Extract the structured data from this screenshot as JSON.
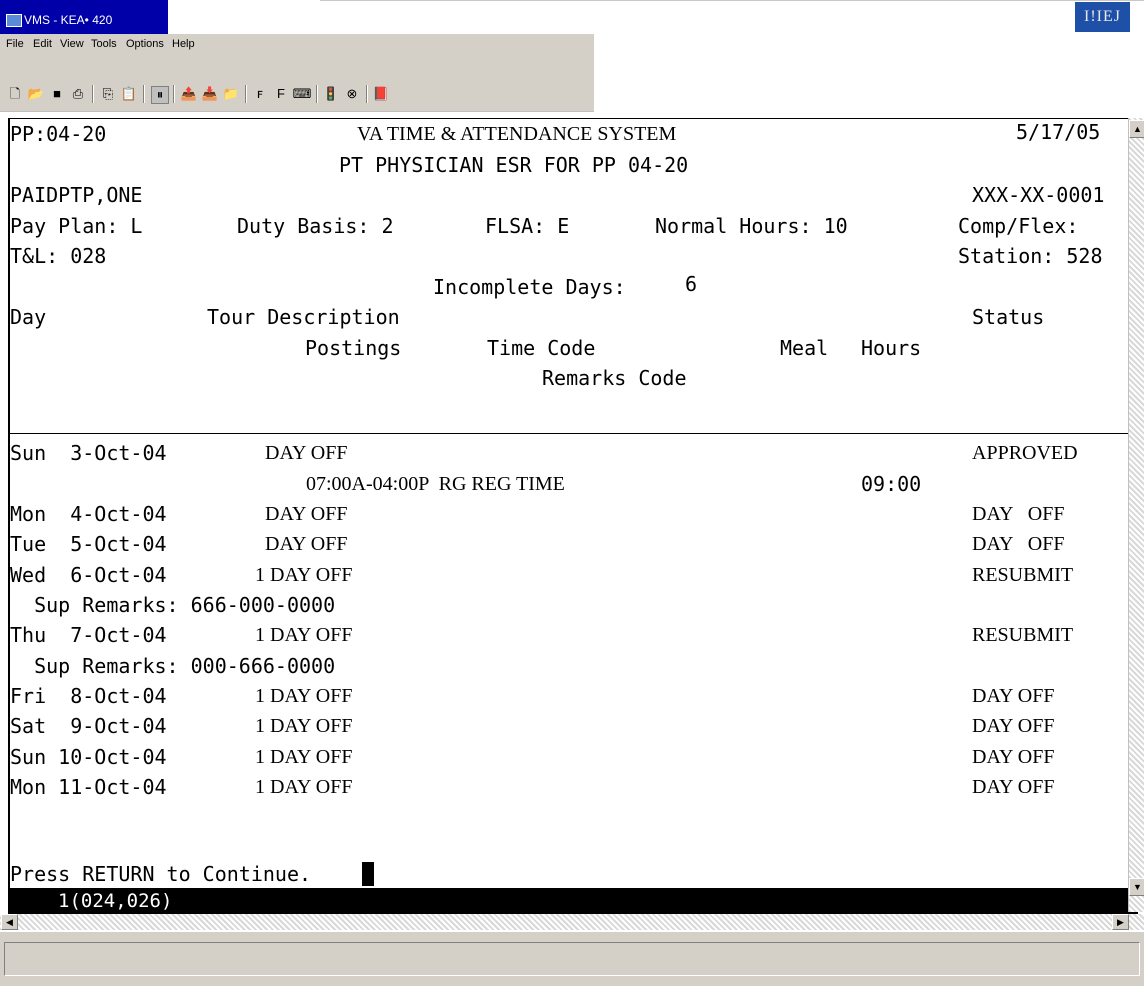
{
  "window": {
    "title": "VMS - KEA• 420",
    "ctrl_label": "I!IEJ"
  },
  "menu": {
    "items": [
      "File",
      "Edit",
      "View",
      "Tools",
      "Options",
      "Help"
    ]
  },
  "toolbar": {
    "icons": [
      "new-icon",
      "open-icon",
      "save-icon",
      "print-icon",
      "copy-icon",
      "paste-icon",
      "capture-icon",
      "send-icon",
      "receive-icon",
      "transfer-icon",
      "font-down-icon",
      "font-up-icon",
      "keyboard-icon",
      "macro-icon",
      "stop-icon",
      "book-icon"
    ]
  },
  "screen": {
    "pp": "PP:04-20",
    "system_title": "VA TIME & ATTENDANCE SYSTEM",
    "date": "5/17/05",
    "subtitle": "PT PHYSICIAN ESR FOR PP 04-20",
    "employee_name": "PAIDPTP,ONE",
    "ssn": "XXX-XX-0001",
    "pay_plan": "Pay Plan: L",
    "duty_basis": "Duty Basis: 2",
    "flsa": "FLSA: E",
    "normal_hours": "Normal Hours: 10",
    "comp_flex": "Comp/Flex:",
    "tl": "T&L: 028",
    "station": "Station: 528",
    "incomplete_label": "Incomplete Days:",
    "incomplete_value": "6",
    "headers": {
      "day": "Day",
      "tour": "Tour Description",
      "status": "Status",
      "postings": "Postings",
      "time_code": "Time Code",
      "meal": "Meal",
      "hours": "Hours",
      "remarks": "Remarks Code"
    },
    "rows": [
      {
        "day": "Sun  3-Oct-04",
        "tour": "  DAY OFF",
        "status": "APPROVED"
      },
      {
        "posting": "07:00A-04:00P  RG REG TIME",
        "hours": "09:00"
      },
      {
        "day": "Mon  4-Oct-04",
        "tour": "  DAY OFF",
        "status": "DAY   OFF"
      },
      {
        "day": "Tue  5-Oct-04",
        "tour": "  DAY OFF",
        "status": "DAY   OFF"
      },
      {
        "day": "Wed  6-Oct-04",
        "tour": "1 DAY OFF",
        "status": "RESUBMIT"
      },
      {
        "remarks": "  Sup Remarks: 666-000-0000"
      },
      {
        "day": "Thu  7-Oct-04",
        "tour": "1 DAY OFF",
        "status": "RESUBMIT"
      },
      {
        "remarks": "  Sup Remarks: 000-666-0000"
      },
      {
        "day": "Fri  8-Oct-04",
        "tour": "1 DAY OFF",
        "status": "DAY OFF"
      },
      {
        "day": "Sat  9-Oct-04",
        "tour": "1 DAY OFF",
        "status": "DAY OFF"
      },
      {
        "day": "Sun 10-Oct-04",
        "tour": "1 DAY OFF",
        "status": "DAY OFF"
      },
      {
        "day": "Mon 11-Oct-04",
        "tour": "1 DAY OFF",
        "status": "DAY OFF"
      }
    ],
    "prompt": "Press RETURN to Continue.",
    "cursor_position": "1(024,026)"
  },
  "colors": {
    "titlebar": "#0000a8",
    "chrome": "#d4d0c8",
    "terminal_bg": "#ffffff",
    "status_line_bg": "#000000"
  }
}
